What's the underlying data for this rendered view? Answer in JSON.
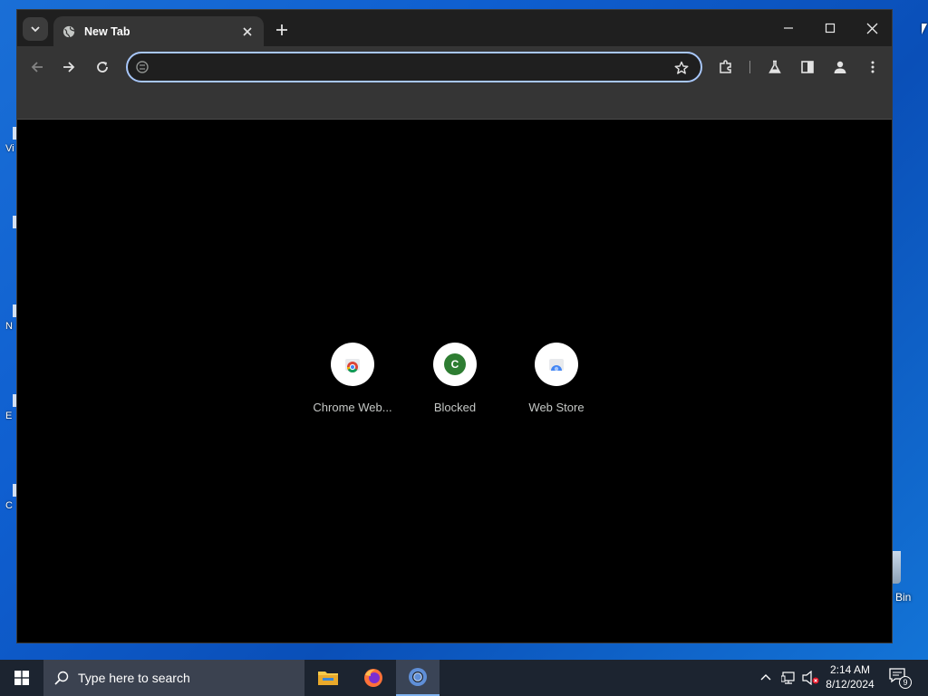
{
  "desktop": {
    "left_labels": [
      "Vi",
      "",
      "N",
      "E",
      "C"
    ],
    "recycle_bin_label": "Bin"
  },
  "browser": {
    "tab": {
      "title": "New Tab"
    },
    "omnibox": {
      "value": "",
      "placeholder": ""
    },
    "shortcuts": [
      {
        "label": "Chrome Web...",
        "icon": "chrome-webstore-icon"
      },
      {
        "label": "Blocked",
        "icon": "letter-c-icon",
        "letter": "C",
        "color": "#2e7d32"
      },
      {
        "label": "Web Store",
        "icon": "webstore-icon"
      }
    ],
    "accent_color": "#a8c7fa"
  },
  "taskbar": {
    "search_placeholder": "Type here to search",
    "clock_time": "2:14 AM",
    "clock_date": "8/12/2024",
    "notification_count": "9"
  }
}
